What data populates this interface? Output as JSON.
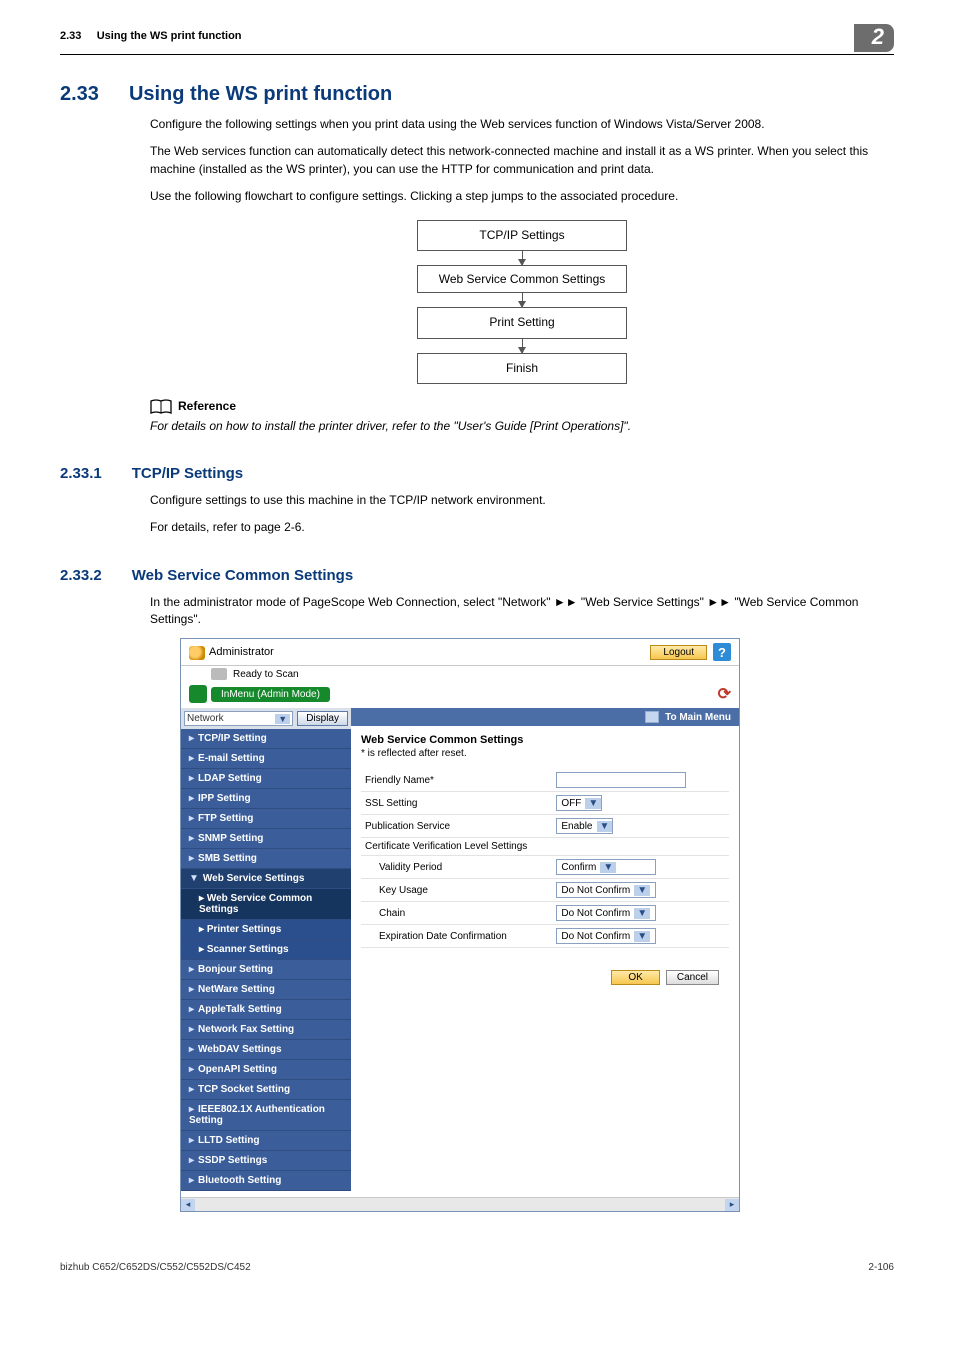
{
  "header": {
    "section_num": "2.33",
    "section_title": "Using the WS print function",
    "chapter": "2"
  },
  "h1": {
    "num": "2.33",
    "text": "Using the WS print function"
  },
  "intro": {
    "p1": "Configure the following settings when you print data using the Web services function of Windows Vista/Server 2008.",
    "p2": "The Web services function can automatically detect this network-connected machine and install it as a WS printer. When you select this machine (installed as the WS printer), you can use the HTTP for communication and print data.",
    "p3": "Use the following flowchart to configure settings. Clicking a step jumps to the associated procedure."
  },
  "flow": {
    "b1": "TCP/IP Settings",
    "b2": "Web Service Common Settings",
    "b3": "Print Setting",
    "b4": "Finish"
  },
  "reference": {
    "label": "Reference",
    "text": "For details on how to install the printer driver, refer to the \"User's Guide [Print Operations]\"."
  },
  "s1": {
    "num": "2.33.1",
    "title": "TCP/IP Settings",
    "p1": "Configure settings to use this machine in the TCP/IP network environment.",
    "p2": "For details, refer to page 2-6."
  },
  "s2": {
    "num": "2.33.2",
    "title": "Web Service Common Settings",
    "p1": "In the administrator mode of PageScope Web Connection, select \"Network\" ►► \"Web Service Settings\" ►► \"Web Service Common Settings\"."
  },
  "screenshot": {
    "admin_label": "Administrator",
    "logout": "Logout",
    "help": "?",
    "status": "Ready to Scan",
    "mode": "InMenu (Admin Mode)",
    "nav_category": "Network",
    "display_btn": "Display",
    "to_main": "To Main Menu",
    "nav": {
      "tcpip": "TCP/IP Setting",
      "email": "E-mail Setting",
      "ldap": "LDAP Setting",
      "ipp": "IPP Setting",
      "ftp": "FTP Setting",
      "snmp": "SNMP Setting",
      "smb": "SMB Setting",
      "wss": "Web Service Settings",
      "wscs": "Web Service Common Settings",
      "prn": "Printer Settings",
      "scn": "Scanner Settings",
      "bonjour": "Bonjour Setting",
      "netware": "NetWare Setting",
      "appletalk": "AppleTalk Setting",
      "netfax": "Network Fax Setting",
      "webdav": "WebDAV Settings",
      "openapi": "OpenAPI Setting",
      "tcpsock": "TCP Socket Setting",
      "ieee": "IEEE802.1X Authentication Setting",
      "lltd": "LLTD Setting",
      "ssdp": "SSDP Settings",
      "bt": "Bluetooth Setting"
    },
    "form": {
      "title": "Web Service Common Settings",
      "note": "* is reflected after reset.",
      "r1": {
        "label": "Friendly Name*",
        "value": ""
      },
      "r2": {
        "label": "SSL Setting",
        "value": "OFF"
      },
      "r3": {
        "label": "Publication Service",
        "value": "Enable"
      },
      "r4": {
        "label": "Certificate Verification Level Settings"
      },
      "r5": {
        "label": "Validity Period",
        "value": "Confirm"
      },
      "r6": {
        "label": "Key Usage",
        "value": "Do Not Confirm"
      },
      "r7": {
        "label": "Chain",
        "value": "Do Not Confirm"
      },
      "r8": {
        "label": "Expiration Date Confirmation",
        "value": "Do Not Confirm"
      },
      "ok": "OK",
      "cancel": "Cancel"
    }
  },
  "footer": {
    "left": "bizhub C652/C652DS/C552/C552DS/C452",
    "right": "2-106"
  }
}
